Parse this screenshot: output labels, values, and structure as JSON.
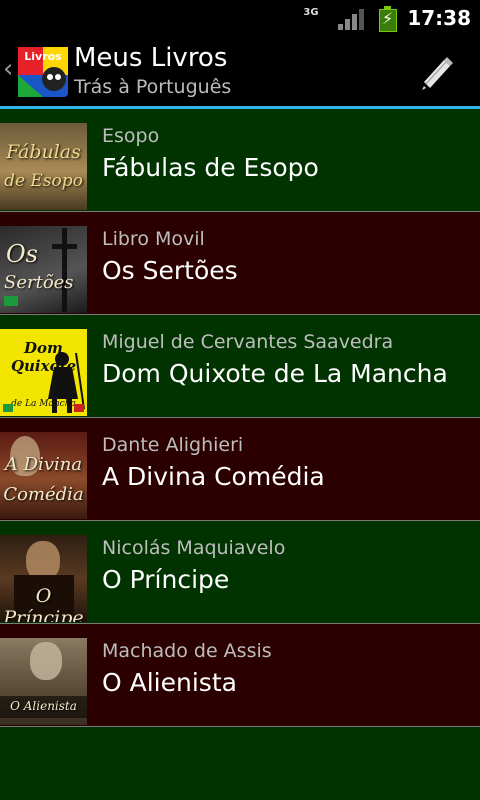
{
  "status": {
    "time": "17:38",
    "network": "3G",
    "signal_icon": "signal-icon",
    "battery_icon": "battery-charging-icon"
  },
  "header": {
    "title": "Meus Livros",
    "subtitle": "Trás à Português",
    "logo_label": "Livros",
    "edit_icon": "pencil-icon"
  },
  "colors": {
    "row_green": "#003300",
    "row_red": "#2b0000",
    "accent": "#33b5e5"
  },
  "books": [
    {
      "author": "Esopo",
      "title": "Fábulas de Esopo",
      "cover_text": [
        "Fábulas",
        "de Esopo"
      ]
    },
    {
      "author": "Libro Movil",
      "title": "Os Sertões",
      "cover_text": [
        "Os",
        "Sertões"
      ]
    },
    {
      "author": "Miguel de Cervantes Saavedra",
      "title": "Dom Quixote de La Mancha",
      "cover_text": [
        "Dom Quixote",
        "de La Mancha"
      ]
    },
    {
      "author": "Dante Alighieri",
      "title": "A Divina Comédia",
      "cover_text": [
        "A Divina",
        "Comédia"
      ]
    },
    {
      "author": "Nicolás Maquiavelo",
      "title": "O Príncipe",
      "cover_text": [
        "O Príncipe"
      ]
    },
    {
      "author": "Machado de Assis",
      "title": "O Alienista",
      "cover_text": [
        "O Alienista"
      ]
    }
  ]
}
